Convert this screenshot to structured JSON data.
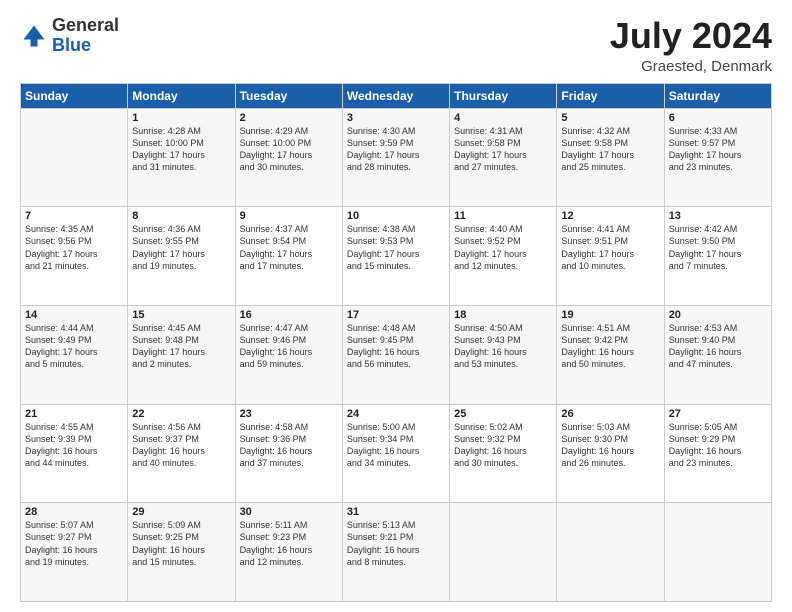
{
  "header": {
    "logo": {
      "general": "General",
      "blue": "Blue"
    },
    "title": "July 2024",
    "location": "Graested, Denmark"
  },
  "weekdays": [
    "Sunday",
    "Monday",
    "Tuesday",
    "Wednesday",
    "Thursday",
    "Friday",
    "Saturday"
  ],
  "weeks": [
    [
      {
        "day": "",
        "sunrise": "",
        "sunset": "",
        "daylight": ""
      },
      {
        "day": "1",
        "sunrise": "Sunrise: 4:28 AM",
        "sunset": "Sunset: 10:00 PM",
        "daylight": "Daylight: 17 hours and 31 minutes."
      },
      {
        "day": "2",
        "sunrise": "Sunrise: 4:29 AM",
        "sunset": "Sunset: 10:00 PM",
        "daylight": "Daylight: 17 hours and 30 minutes."
      },
      {
        "day": "3",
        "sunrise": "Sunrise: 4:30 AM",
        "sunset": "Sunset: 9:59 PM",
        "daylight": "Daylight: 17 hours and 28 minutes."
      },
      {
        "day": "4",
        "sunrise": "Sunrise: 4:31 AM",
        "sunset": "Sunset: 9:58 PM",
        "daylight": "Daylight: 17 hours and 27 minutes."
      },
      {
        "day": "5",
        "sunrise": "Sunrise: 4:32 AM",
        "sunset": "Sunset: 9:58 PM",
        "daylight": "Daylight: 17 hours and 25 minutes."
      },
      {
        "day": "6",
        "sunrise": "Sunrise: 4:33 AM",
        "sunset": "Sunset: 9:57 PM",
        "daylight": "Daylight: 17 hours and 23 minutes."
      }
    ],
    [
      {
        "day": "7",
        "sunrise": "Sunrise: 4:35 AM",
        "sunset": "Sunset: 9:56 PM",
        "daylight": "Daylight: 17 hours and 21 minutes."
      },
      {
        "day": "8",
        "sunrise": "Sunrise: 4:36 AM",
        "sunset": "Sunset: 9:55 PM",
        "daylight": "Daylight: 17 hours and 19 minutes."
      },
      {
        "day": "9",
        "sunrise": "Sunrise: 4:37 AM",
        "sunset": "Sunset: 9:54 PM",
        "daylight": "Daylight: 17 hours and 17 minutes."
      },
      {
        "day": "10",
        "sunrise": "Sunrise: 4:38 AM",
        "sunset": "Sunset: 9:53 PM",
        "daylight": "Daylight: 17 hours and 15 minutes."
      },
      {
        "day": "11",
        "sunrise": "Sunrise: 4:40 AM",
        "sunset": "Sunset: 9:52 PM",
        "daylight": "Daylight: 17 hours and 12 minutes."
      },
      {
        "day": "12",
        "sunrise": "Sunrise: 4:41 AM",
        "sunset": "Sunset: 9:51 PM",
        "daylight": "Daylight: 17 hours and 10 minutes."
      },
      {
        "day": "13",
        "sunrise": "Sunrise: 4:42 AM",
        "sunset": "Sunset: 9:50 PM",
        "daylight": "Daylight: 17 hours and 7 minutes."
      }
    ],
    [
      {
        "day": "14",
        "sunrise": "Sunrise: 4:44 AM",
        "sunset": "Sunset: 9:49 PM",
        "daylight": "Daylight: 17 hours and 5 minutes."
      },
      {
        "day": "15",
        "sunrise": "Sunrise: 4:45 AM",
        "sunset": "Sunset: 9:48 PM",
        "daylight": "Daylight: 17 hours and 2 minutes."
      },
      {
        "day": "16",
        "sunrise": "Sunrise: 4:47 AM",
        "sunset": "Sunset: 9:46 PM",
        "daylight": "Daylight: 16 hours and 59 minutes."
      },
      {
        "day": "17",
        "sunrise": "Sunrise: 4:48 AM",
        "sunset": "Sunset: 9:45 PM",
        "daylight": "Daylight: 16 hours and 56 minutes."
      },
      {
        "day": "18",
        "sunrise": "Sunrise: 4:50 AM",
        "sunset": "Sunset: 9:43 PM",
        "daylight": "Daylight: 16 hours and 53 minutes."
      },
      {
        "day": "19",
        "sunrise": "Sunrise: 4:51 AM",
        "sunset": "Sunset: 9:42 PM",
        "daylight": "Daylight: 16 hours and 50 minutes."
      },
      {
        "day": "20",
        "sunrise": "Sunrise: 4:53 AM",
        "sunset": "Sunset: 9:40 PM",
        "daylight": "Daylight: 16 hours and 47 minutes."
      }
    ],
    [
      {
        "day": "21",
        "sunrise": "Sunrise: 4:55 AM",
        "sunset": "Sunset: 9:39 PM",
        "daylight": "Daylight: 16 hours and 44 minutes."
      },
      {
        "day": "22",
        "sunrise": "Sunrise: 4:56 AM",
        "sunset": "Sunset: 9:37 PM",
        "daylight": "Daylight: 16 hours and 40 minutes."
      },
      {
        "day": "23",
        "sunrise": "Sunrise: 4:58 AM",
        "sunset": "Sunset: 9:36 PM",
        "daylight": "Daylight: 16 hours and 37 minutes."
      },
      {
        "day": "24",
        "sunrise": "Sunrise: 5:00 AM",
        "sunset": "Sunset: 9:34 PM",
        "daylight": "Daylight: 16 hours and 34 minutes."
      },
      {
        "day": "25",
        "sunrise": "Sunrise: 5:02 AM",
        "sunset": "Sunset: 9:32 PM",
        "daylight": "Daylight: 16 hours and 30 minutes."
      },
      {
        "day": "26",
        "sunrise": "Sunrise: 5:03 AM",
        "sunset": "Sunset: 9:30 PM",
        "daylight": "Daylight: 16 hours and 26 minutes."
      },
      {
        "day": "27",
        "sunrise": "Sunrise: 5:05 AM",
        "sunset": "Sunset: 9:29 PM",
        "daylight": "Daylight: 16 hours and 23 minutes."
      }
    ],
    [
      {
        "day": "28",
        "sunrise": "Sunrise: 5:07 AM",
        "sunset": "Sunset: 9:27 PM",
        "daylight": "Daylight: 16 hours and 19 minutes."
      },
      {
        "day": "29",
        "sunrise": "Sunrise: 5:09 AM",
        "sunset": "Sunset: 9:25 PM",
        "daylight": "Daylight: 16 hours and 15 minutes."
      },
      {
        "day": "30",
        "sunrise": "Sunrise: 5:11 AM",
        "sunset": "Sunset: 9:23 PM",
        "daylight": "Daylight: 16 hours and 12 minutes."
      },
      {
        "day": "31",
        "sunrise": "Sunrise: 5:13 AM",
        "sunset": "Sunset: 9:21 PM",
        "daylight": "Daylight: 16 hours and 8 minutes."
      },
      {
        "day": "",
        "sunrise": "",
        "sunset": "",
        "daylight": ""
      },
      {
        "day": "",
        "sunrise": "",
        "sunset": "",
        "daylight": ""
      },
      {
        "day": "",
        "sunrise": "",
        "sunset": "",
        "daylight": ""
      }
    ]
  ]
}
